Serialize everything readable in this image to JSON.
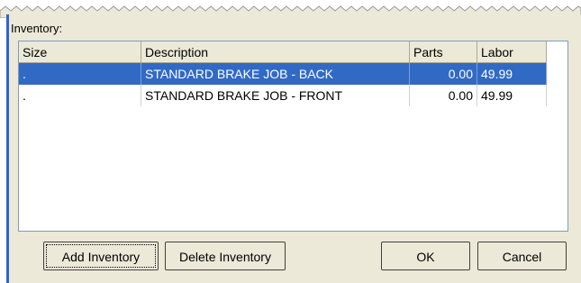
{
  "dialog": {
    "inventory_label": "Inventory:"
  },
  "table": {
    "columns": [
      "Size",
      "Description",
      "Parts",
      "Labor"
    ],
    "rows": [
      {
        "size": ".",
        "description": "STANDARD BRAKE JOB - BACK",
        "parts": "0.00",
        "labor": "49.99",
        "selected": true
      },
      {
        "size": ".",
        "description": "STANDARD BRAKE JOB - FRONT",
        "parts": "0.00",
        "labor": "49.99",
        "selected": false
      }
    ]
  },
  "buttons": {
    "add_inventory": "Add Inventory",
    "delete_inventory": "Delete Inventory",
    "ok": "OK",
    "cancel": "Cancel"
  },
  "colors": {
    "selection": "#316ac5",
    "window_border_accent": "#2f63d6",
    "dialog_face": "#ece9d8"
  }
}
